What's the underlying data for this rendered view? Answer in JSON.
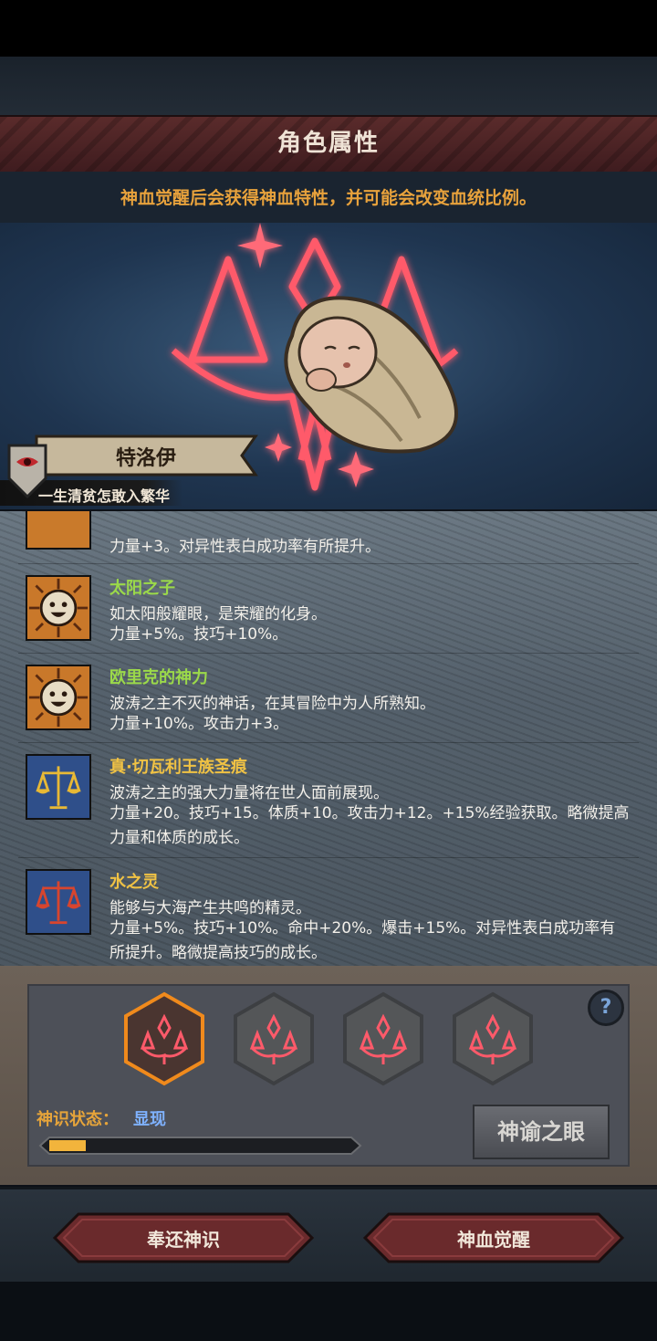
{
  "header": {
    "title": "角色属性",
    "hint": "神血觉醒后会获得神血特性，并可能会改变血统比例。"
  },
  "character": {
    "name": "特洛伊",
    "motto": "一生清贫怎敢入繁华"
  },
  "traits": [
    {
      "name": "",
      "desc": "",
      "effect": "力量+3。对异性表白成功率有所提升。",
      "icon": "sun-face-icon",
      "name_color": "#9bd94a"
    },
    {
      "name": "太阳之子",
      "desc": "如太阳般耀眼，是荣耀的化身。",
      "effect": "力量+5%。技巧+10%。",
      "icon": "sun-face-icon",
      "name_color": "#9bd94a"
    },
    {
      "name": "欧里克的神力",
      "desc": "波涛之主不灭的神话，在其冒险中为人所熟知。",
      "effect": "力量+10%。攻击力+3。",
      "icon": "sun-face-icon",
      "name_color": "#9bd94a"
    },
    {
      "name": "真·切瓦利王族圣痕",
      "desc": "波涛之主的强大力量将在世人面前展现。",
      "effect": "力量+20。技巧+15。体质+10。攻击力+12。+15%经验获取。略微提高力量和体质的成长。",
      "icon": "golden-scales-icon",
      "name_color": "#f0c244"
    },
    {
      "name": "水之灵",
      "desc": "能够与大海产生共鸣的精灵。",
      "effect": "力量+5%。技巧+10%。命中+20%。爆击+15%。对异性表白成功率有所提升。略微提高技巧的成长。",
      "icon": "red-scales-icon",
      "name_color": "#f0c244"
    }
  ],
  "divine": {
    "status_label": "神识状态：",
    "status_value": "显现",
    "progress": 0.12,
    "oracle_button": "神谕之眼",
    "help": "?"
  },
  "actions": {
    "return": "奉还神识",
    "awaken": "神血觉醒"
  },
  "colors": {
    "accent_orange": "#e8a23c",
    "status_blue": "#7fb2ff",
    "glyph_red": "#ff4a5a"
  }
}
